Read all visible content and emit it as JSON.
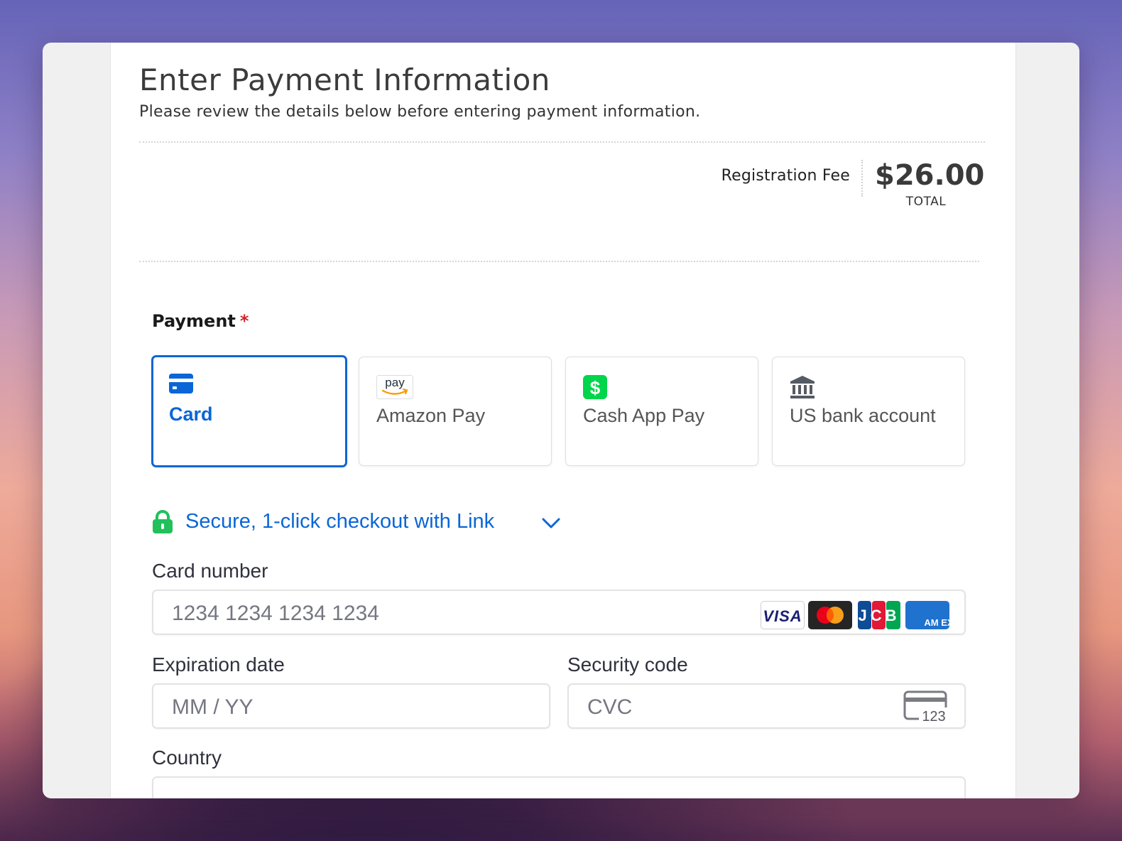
{
  "header": {
    "title": "Enter Payment Information",
    "subtitle": "Please review the details below before entering payment information."
  },
  "summary": {
    "fee_label": "Registration Fee",
    "amount": "$26.00",
    "total_label": "TOTAL"
  },
  "payment": {
    "label": "Payment",
    "required_marker": "*",
    "methods": [
      {
        "label": "Card",
        "icon": "card-icon",
        "selected": true
      },
      {
        "label": "Amazon Pay",
        "icon": "amazon-pay-icon",
        "selected": false
      },
      {
        "label": "Cash App Pay",
        "icon": "cash-app-icon",
        "selected": false
      },
      {
        "label": "US bank account",
        "icon": "bank-icon",
        "selected": false
      }
    ],
    "amazon_icon_text": "pay",
    "cashapp_icon_text": "$"
  },
  "link": {
    "text": "Secure, 1-click checkout with Link"
  },
  "form": {
    "card_number_label": "Card number",
    "card_number_placeholder": "1234 1234 1234 1234",
    "expiry_label": "Expiration date",
    "expiry_placeholder": "MM / YY",
    "cvc_label": "Security code",
    "cvc_placeholder": "CVC",
    "cvc_icon_text": "123",
    "country_label": "Country"
  },
  "card_brands": {
    "visa": "VISA",
    "jcb": "JCB",
    "amex": "AM EX"
  },
  "colors": {
    "accent": "#0a66d6",
    "required": "#d02525",
    "link_lock": "#21c05b",
    "cashapp": "#00d54b"
  }
}
